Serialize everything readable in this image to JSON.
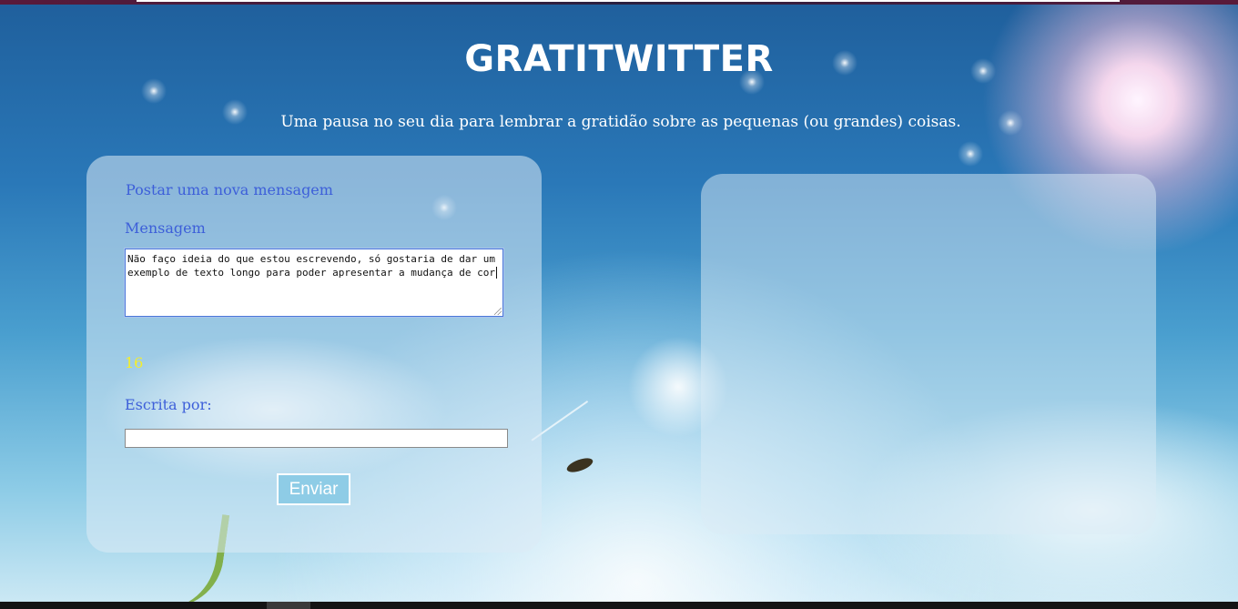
{
  "header": {
    "title": "GRATITWITTER",
    "subtitle": "Uma pausa no seu dia para lembrar a gratidão sobre as pequenas (ou grandes) coisas."
  },
  "form": {
    "heading": "Postar uma nova mensagem",
    "message_label": "Mensagem",
    "message_value": "Não faço ideia do que estou escrevendo, só gostaria de dar um exemplo de texto longo para poder apresentar a mudança de cor ",
    "char_counter": "16",
    "author_label": "Escrita por:",
    "author_value": "",
    "submit_label": "Enviar"
  },
  "colors": {
    "label_blue": "#3d5fd9",
    "counter_yellow": "#f5ee2a",
    "button_bg": "#8ecce6"
  }
}
